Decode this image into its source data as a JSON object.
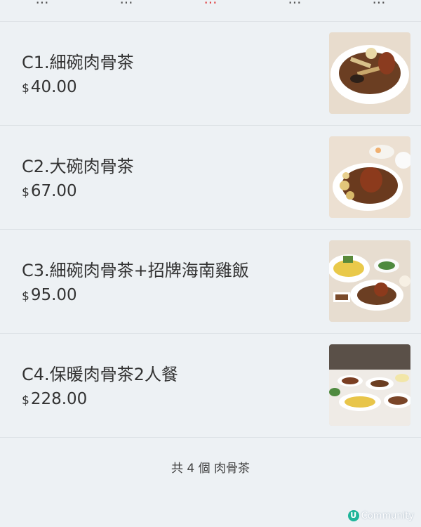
{
  "tabs": [
    "...",
    "...",
    "...",
    "...",
    "..."
  ],
  "items": [
    {
      "name": "C1.細碗肉骨茶",
      "currency": "$",
      "price": "40.00"
    },
    {
      "name": "C2.大碗肉骨茶",
      "currency": "$",
      "price": "67.00"
    },
    {
      "name": "C3.細碗肉骨茶+招牌海南雞飯",
      "currency": "$",
      "price": "95.00"
    },
    {
      "name": "C4.保暖肉骨茶2人餐",
      "currency": "$",
      "price": "228.00"
    }
  ],
  "footer": "共 4 個 肉骨茶",
  "brand": {
    "logo": "U",
    "text": "Community"
  },
  "colors": {
    "background": "#edf1f4",
    "active_tab": "#e04848",
    "brand": "#1fb59a"
  }
}
